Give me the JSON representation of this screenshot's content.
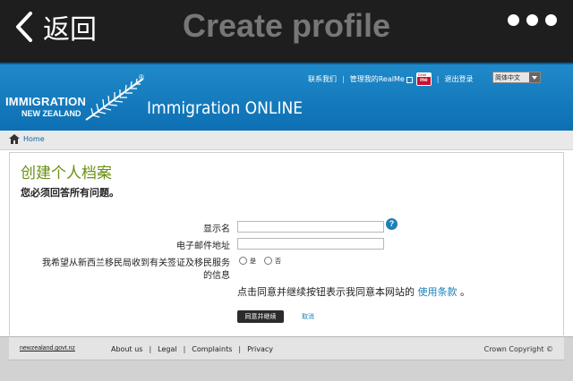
{
  "nav": {
    "back_label": "返回",
    "title": "Create profile"
  },
  "banner": {
    "logo_line1": "IMMIGRATION",
    "logo_line2": "NEW ZEALAND",
    "reg_mark": "®",
    "brand_title": "Immigration ONLINE",
    "links": {
      "contact": "联系我们",
      "manage_realme": "管理我的RealMe",
      "logout": "退出登录"
    },
    "realme_badge_top": "Dealt",
    "realme_badge_main": "me",
    "language_selected": "简体中文"
  },
  "breadcrumb": {
    "home": "Home"
  },
  "form": {
    "title": "创建个人档案",
    "note": "您必须回答所有问题。",
    "display_name_label": "显示名",
    "email_label": "电子邮件地址",
    "consent_label_line1": "我希望从新西兰移民局收到有关签证及移民服务",
    "consent_label_line2": "的信息",
    "help_glyph": "?",
    "option_yes": "是",
    "option_no": "否",
    "terms_text": "点击同意并继续按钮表示我同意本网站的 ",
    "terms_link": "使用条款",
    "terms_end": " 。",
    "agree_button": "同意并继续",
    "cancel_button": "取消"
  },
  "footer": {
    "govt_logo": "newzealand.govt.nz",
    "about": "About us",
    "legal": "Legal",
    "complaints": "Complaints",
    "privacy": "Privacy",
    "copyright": "Crown Copyright ©"
  },
  "colors": {
    "banner_blue": "#1f8ac9",
    "title_green": "#6b8f12",
    "link_blue": "#1a7fb7",
    "help_blue": "#1f7fb5"
  }
}
